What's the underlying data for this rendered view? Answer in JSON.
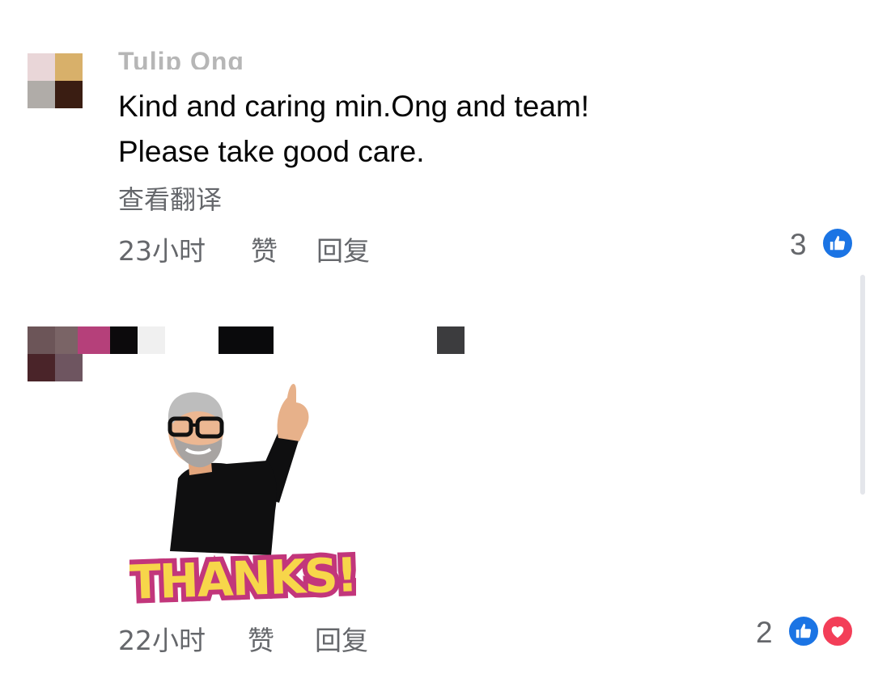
{
  "comments": [
    {
      "author_partial": "Tulip Ong",
      "text_line1": "Kind and caring min.Ong and team!",
      "text_line2": "Please take good care.",
      "translate_label": "查看翻译",
      "time": "23小时",
      "like_label": "赞",
      "reply_label": "回复",
      "reaction_count": "3",
      "reactions": [
        "like-icon"
      ]
    },
    {
      "sticker_text": "THANKS!",
      "time": "22小时",
      "like_label": "赞",
      "reply_label": "回复",
      "reaction_count": "2",
      "reactions": [
        "like-icon",
        "love-icon"
      ]
    }
  ],
  "colors": {
    "like_blue": "#1b74e4",
    "love_red": "#f33e58",
    "meta_gray": "#65676b"
  }
}
